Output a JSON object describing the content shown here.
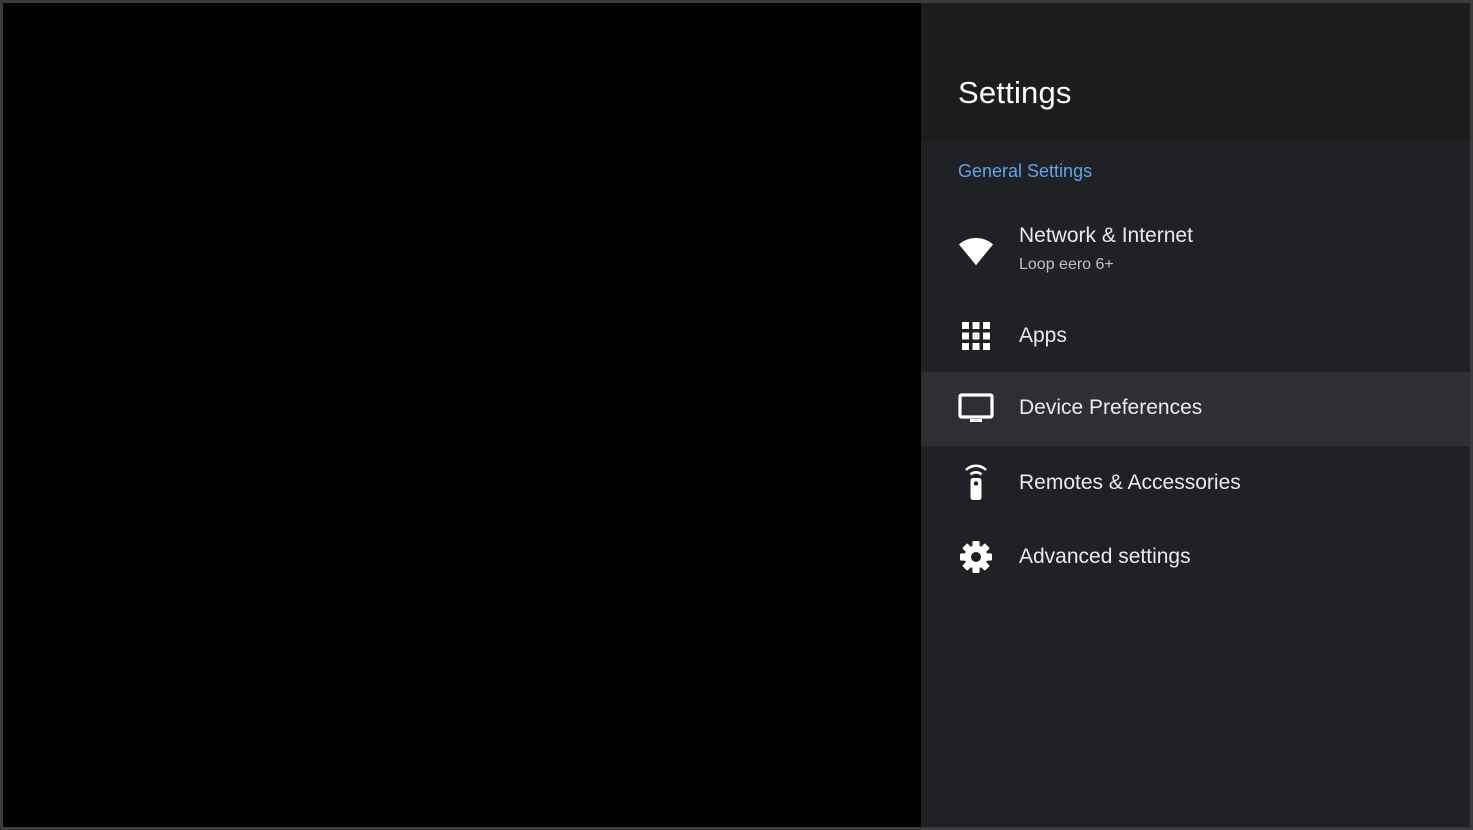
{
  "panel": {
    "title": "Settings",
    "section_header": "General Settings",
    "accent_color": "#5ea5ef",
    "items": [
      {
        "icon": "wifi-icon",
        "label": "Network & Internet",
        "sublabel": "Loop eero 6+",
        "selected": false
      },
      {
        "icon": "apps-grid-icon",
        "label": "Apps",
        "selected": false
      },
      {
        "icon": "tv-icon",
        "label": "Device Preferences",
        "selected": true
      },
      {
        "icon": "remote-icon",
        "label": "Remotes & Accessories",
        "selected": false
      },
      {
        "icon": "gear-icon",
        "label": "Advanced settings",
        "selected": false
      }
    ]
  }
}
